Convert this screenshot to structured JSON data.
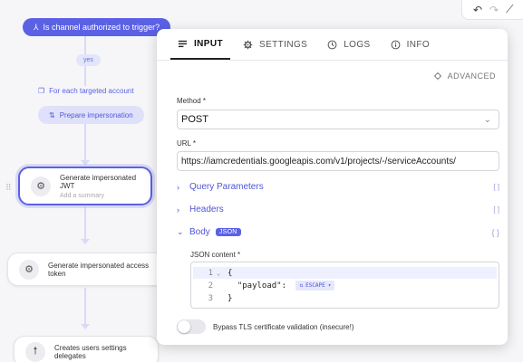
{
  "canvas": {
    "condition": "Is channel authorized to trigger?",
    "yes_label": "yes",
    "for_each": "For each targeted account",
    "prepare": "Prepare impersonation",
    "node1": {
      "title": "Generate impersonated JWT",
      "subtitle": "Add a summary"
    },
    "node2": {
      "title": "Generate impersonated access token"
    },
    "node3": {
      "title": "Creates users settings delegates"
    }
  },
  "tabs": [
    {
      "label": "INPUT",
      "icon": "list-icon",
      "active": true
    },
    {
      "label": "SETTINGS",
      "icon": "gear-icon"
    },
    {
      "label": "LOGS",
      "icon": "clock-icon"
    },
    {
      "label": "INFO",
      "icon": "info-icon"
    }
  ],
  "advanced_label": "ADVANCED",
  "method": {
    "label": "Method *",
    "value": "POST"
  },
  "url": {
    "label": "URL *",
    "value": "https://iamcredentials.googleapis.com/v1/projects/-/serviceAccounts/"
  },
  "sections": {
    "query": "Query Parameters",
    "headers": "Headers",
    "body": "Body",
    "body_badge": "JSON"
  },
  "json_content": {
    "label": "JSON content *",
    "lines": [
      {
        "n": "1",
        "text": "{"
      },
      {
        "n": "2",
        "text": "  \"payload\": "
      },
      {
        "n": "3",
        "text": "}"
      }
    ],
    "escape_label": "ESCAPE"
  },
  "bypass_tls_label": "Bypass TLS certificate validation (insecure!)",
  "colors": {
    "accent": "#5b61e5",
    "link": "#4f55d8"
  }
}
